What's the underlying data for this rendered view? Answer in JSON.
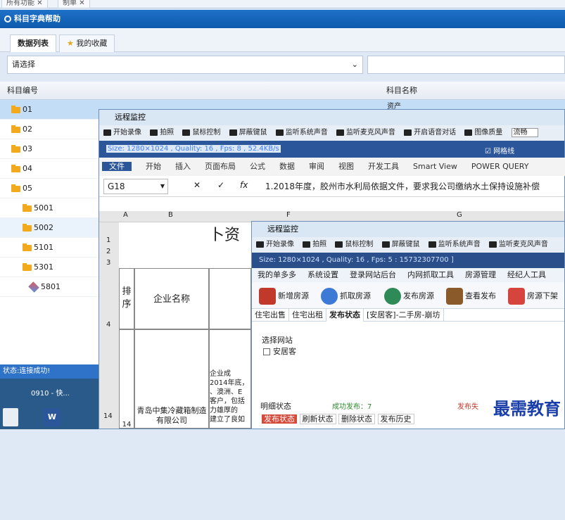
{
  "top_tabs": [
    "所有功能",
    "制单"
  ],
  "module_title": "科目字典帮助",
  "subtabs": [
    "数据列表",
    "我的收藏"
  ],
  "select_placeholder": "请选择",
  "columns": [
    "科目编号",
    "科目名称"
  ],
  "tree": [
    {
      "code": "01",
      "level": 0,
      "arrow": "▶",
      "selected": true
    },
    {
      "code": "02",
      "level": 0,
      "arrow": "▶"
    },
    {
      "code": "03",
      "level": 0,
      "arrow": "▶"
    },
    {
      "code": "04",
      "level": 0,
      "arrow": "▶"
    },
    {
      "code": "05",
      "level": 0,
      "arrow": "◢"
    },
    {
      "code": "5001",
      "level": 1,
      "arrow": "▶"
    },
    {
      "code": "5002",
      "level": 1,
      "arrow": "▶"
    },
    {
      "code": "5101",
      "level": 1,
      "arrow": "▶"
    },
    {
      "code": "5301",
      "level": 1,
      "arrow": "▶"
    },
    {
      "code": "5801",
      "level": 1,
      "arrow": ""
    }
  ],
  "name_first_row": "资产",
  "status": "状态:连接成功!",
  "desktop_text": "0910 - 快...",
  "remote1": {
    "title": "远程监控",
    "toolbar": [
      "开始录像",
      "拍照",
      "鼠标控制",
      "屏蔽键鼠",
      "监听系统声音",
      "监听麦克风声音",
      "开启语音对话",
      "图像质量"
    ],
    "quality": "流畅",
    "info": "Size: 1280×1024 , Quality: 16 , Fps: 8 , 52.4KB/s",
    "ribbon_tabs": [
      "文件",
      "开始",
      "插入",
      "页面布局",
      "公式",
      "数据",
      "审阅",
      "视图",
      "开发工具",
      "Smart View",
      "POWER QUERY"
    ],
    "cell_ref": "G18",
    "formula": "1.2018年度，胶州市水利局依据文件，要求我公司缴纳水土保持设施补偿",
    "col_labels": [
      "A",
      "B",
      "F",
      "G"
    ],
    "row_nums": [
      "1",
      "2",
      "3",
      "4",
      "",
      "14"
    ],
    "sheet_title": "卜资",
    "hdr_seq": "排序",
    "hdr_name": "企业名称",
    "row14_seq": "14",
    "row14_name": "青岛中集冷藏箱制造有限公司",
    "cell_text": "企业成\n2014年底，\n、澳洲、E\n客户，包括\n力雄厚的\n建立了良如"
  },
  "remote2": {
    "title": "远程监控",
    "toolbar": [
      "开始录像",
      "拍照",
      "鼠标控制",
      "屏蔽键鼠",
      "监听系统声音",
      "监听麦克风声音"
    ],
    "info": "Size: 1280×1024 , Quality: 16 , Fps: 5 : 15732307700 ]",
    "menu": [
      "我的单多多",
      "系统设置",
      "登录网站后台",
      "内网抓取工具",
      "房源管理",
      "经纪人工具"
    ],
    "tools": [
      "新增房源",
      "抓取房源",
      "发布房源",
      "查看发布",
      "房源下架"
    ],
    "tabs": [
      "住宅出售",
      "住宅出租",
      "发布状态",
      "[安居客]-二手房-崩坊"
    ],
    "site_label": "选择网站",
    "site_option": "安居客",
    "detail": "明细状态",
    "success": "成功发布：7",
    "fail": "发布失",
    "bottom_tabs": [
      "发布状态",
      "刷新状态",
      "删除状态",
      "发布历史"
    ]
  },
  "watermark": "最需教育"
}
